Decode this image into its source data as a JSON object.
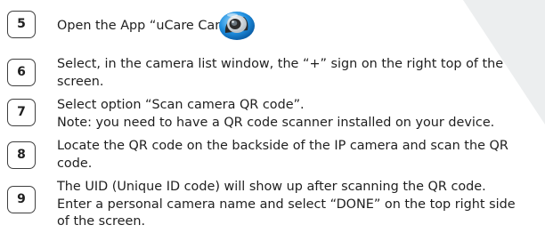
{
  "steps": [
    {
      "number": "5",
      "lines": [
        "Open the App “uCare Cam”."
      ],
      "app_icon": "camera-app-icon"
    },
    {
      "number": "6",
      "lines": [
        "Select, in the camera list window, the “+” sign on the right top of the",
        "screen."
      ]
    },
    {
      "number": "7",
      "lines": [
        "Select option “Scan camera QR code”.",
        "Note: you need to have a QR code scanner installed on your device."
      ]
    },
    {
      "number": "8",
      "lines": [
        "Locate the QR code on the backside of the IP camera and scan the QR",
        "code."
      ]
    },
    {
      "number": "9",
      "lines": [
        "The UID (Unique ID code) will show up after scanning the QR code.",
        "Enter a personal camera name and select “DONE” on the top right side",
        "of the screen."
      ]
    }
  ]
}
